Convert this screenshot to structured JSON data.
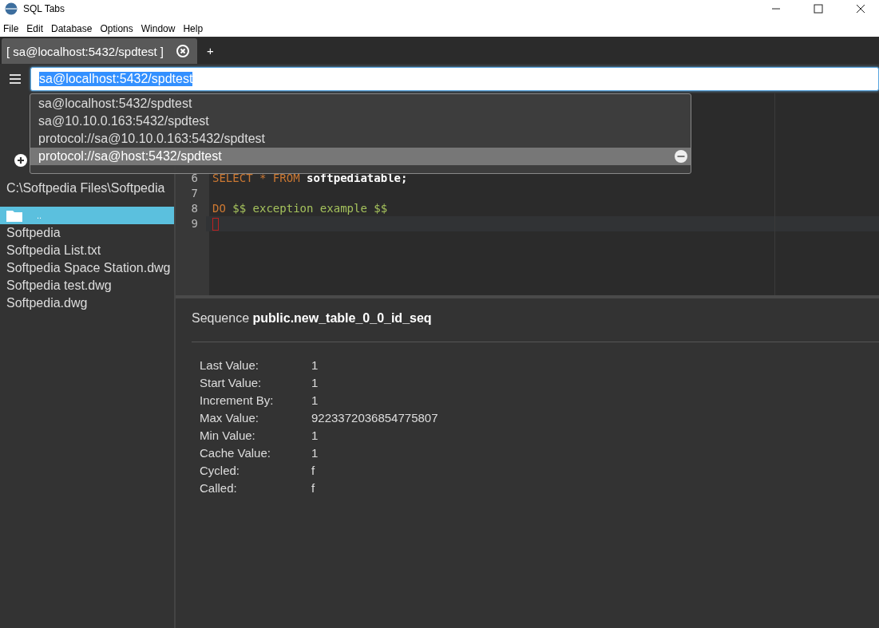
{
  "window": {
    "title": "SQL Tabs"
  },
  "menu": [
    "File",
    "Edit",
    "Database",
    "Options",
    "Window",
    "Help"
  ],
  "tabs": [
    {
      "label": "[ sa@localhost:5432/spdtest ]",
      "selected": true
    }
  ],
  "new_tab": "+",
  "connection": {
    "value": "sa@localhost:5432/spdtest"
  },
  "suggestions": [
    {
      "label": "sa@localhost:5432/spdtest",
      "selected": false
    },
    {
      "label": "sa@10.10.0.163:5432/spdtest",
      "selected": false
    },
    {
      "label": "protocol://sa@10.10.0.163:5432/spdtest",
      "selected": false
    },
    {
      "label": "protocol://sa@host:5432/spdtest",
      "selected": true
    }
  ],
  "sidebar": {
    "path": "C:\\Softpedia Files\\Softpedia",
    "items": [
      {
        "kind": "folder",
        "label": "..",
        "selected": true
      },
      {
        "kind": "file",
        "label": "Softpedia",
        "selected": false
      },
      {
        "kind": "file",
        "label": "Softpedia List.txt",
        "selected": false
      },
      {
        "kind": "file",
        "label": "Softpedia Space Station.dwg",
        "selected": false
      },
      {
        "kind": "file",
        "label": "Softpedia test.dwg",
        "selected": false
      },
      {
        "kind": "file",
        "label": "Softpedia.dwg",
        "selected": false
      }
    ]
  },
  "editor": {
    "lines": [
      {
        "number": "6",
        "tokens": [
          {
            "kind": "keyword",
            "text": "SELECT * FROM"
          },
          {
            "kind": "name",
            "text": "softpediatable;"
          }
        ]
      },
      {
        "number": "7"
      },
      {
        "number": "8",
        "tokens": [
          {
            "kind": "keyword",
            "text": "DO"
          },
          {
            "kind": "string",
            "text": "$$ exception example $$"
          }
        ]
      },
      {
        "number": "9",
        "cursor": true
      }
    ]
  },
  "result": {
    "label": "Sequence",
    "name": "public.new_table_0_0_id_seq",
    "properties": [
      {
        "key": "Last Value:",
        "value": "1"
      },
      {
        "key": "Start Value:",
        "value": "1"
      },
      {
        "key": "Increment By:",
        "value": "1"
      },
      {
        "key": "Max Value:",
        "value": "9223372036854775807"
      },
      {
        "key": "Min Value:",
        "value": "1"
      },
      {
        "key": "Cache Value:",
        "value": "1"
      },
      {
        "key": "Cycled:",
        "value": "f"
      },
      {
        "key": "Called:",
        "value": "f"
      }
    ]
  }
}
